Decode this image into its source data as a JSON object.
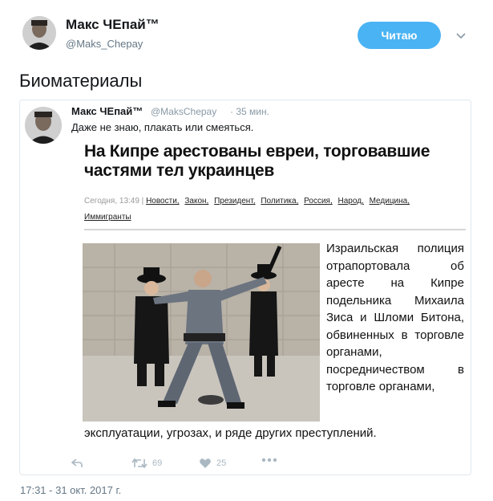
{
  "header": {
    "author_name": "Макс ЧЕпай™",
    "author_handle": "@Maks_Chepay",
    "follow_label": "Читаю"
  },
  "tweet": {
    "text": "Биоматериалы",
    "timestamp": "17:31 - 31 окт. 2017 г."
  },
  "quoted": {
    "author_name": "Макс ЧЕпай™",
    "author_handle": "@MaksChepay",
    "time": "· 35 мин.",
    "text": "Даже не знаю, плакать или смеяться.",
    "article": {
      "headline": "На Кипре арестованы евреи, торговавшие частями тел украинцев",
      "date": "Сегодня, 13:49 |",
      "tags": [
        "Новости,",
        "Закон,",
        "Президент,",
        "Политика,",
        "Россия,",
        "Народ,",
        "Медицина,",
        "Иммигранты"
      ],
      "body_side": "Израильская полиция отрапортовала об аресте на Кипре подельника Михаила Зиса и Шломи Битона, обвиненных в торговле органами, посредничеством в торговле органами,",
      "body_bottom": "эксплуатации, угрозах, и ряде других преступлений."
    },
    "actions": {
      "retweets": "69",
      "likes": "25"
    }
  },
  "colors": {
    "follow_button": "#4ab3f4",
    "secondary_text": "#657786",
    "card_border": "#e1e8ed"
  },
  "icons": [
    "chevron-down-icon",
    "reply-icon",
    "retweet-icon",
    "like-icon",
    "more-icon"
  ]
}
